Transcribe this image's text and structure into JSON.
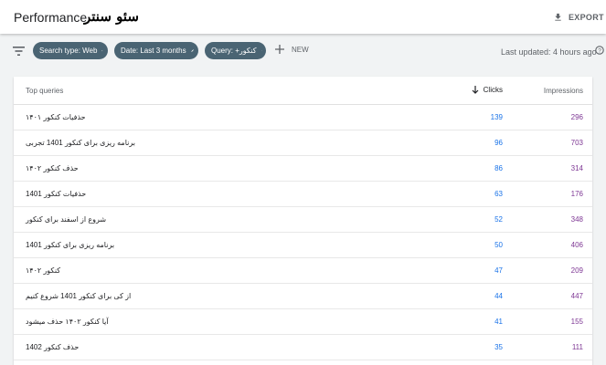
{
  "header": {
    "title": "Performance",
    "brand": "سئو سنتر",
    "export_label": "EXPORT"
  },
  "filters": {
    "chips": [
      {
        "label": "Search type: Web"
      },
      {
        "label": "Date: Last 3 months"
      },
      {
        "label": "Query: +کنکور"
      }
    ],
    "new_label": "NEW",
    "last_updated": "Last updated: 4 hours ago"
  },
  "table": {
    "columns": {
      "query": "Top queries",
      "clicks": "Clicks",
      "impressions": "Impressions"
    },
    "rows": [
      {
        "query": "حذفیات کنکور ۱۴۰۱",
        "clicks": "139",
        "impressions": "296"
      },
      {
        "query": "برنامه ریزی برای کنکور 1401 تجربی",
        "clicks": "96",
        "impressions": "703"
      },
      {
        "query": "حذف کنکور ۱۴۰۲",
        "clicks": "86",
        "impressions": "314"
      },
      {
        "query": "حذفیات کنکور 1401",
        "clicks": "63",
        "impressions": "176"
      },
      {
        "query": "شروع از اسفند برای کنکور",
        "clicks": "52",
        "impressions": "348"
      },
      {
        "query": "برنامه ریزی برای کنکور 1401",
        "clicks": "50",
        "impressions": "406"
      },
      {
        "query": "کنکور ۱۴۰۲",
        "clicks": "47",
        "impressions": "209"
      },
      {
        "query": "از کی برای کنکور 1401 شروع کنیم",
        "clicks": "44",
        "impressions": "447"
      },
      {
        "query": "آیا کنکور ۱۴۰۲ حذف میشود",
        "clicks": "41",
        "impressions": "155"
      },
      {
        "query": "حذف کنکور 1402",
        "clicks": "35",
        "impressions": "111"
      }
    ]
  },
  "colors": {
    "chip_bg": "#4a6473",
    "clicks": "#1a73e8",
    "impressions": "#7e3794"
  }
}
